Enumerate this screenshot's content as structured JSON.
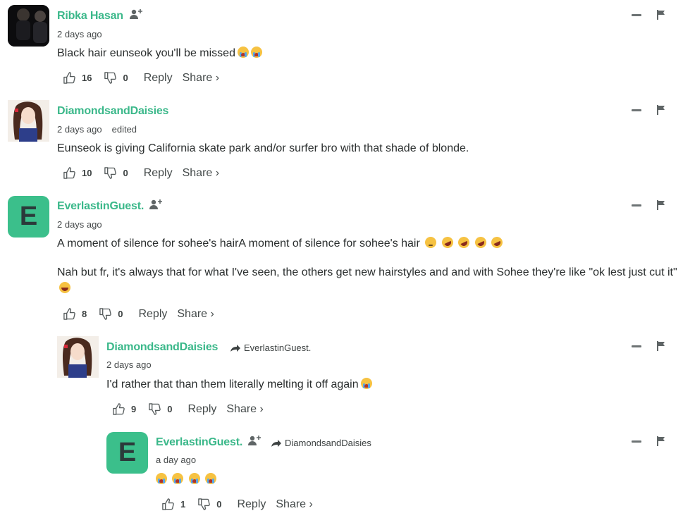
{
  "colors": {
    "accent": "#3bb88a",
    "avatar_bg": "#3bbf8b",
    "text": "#2a2e2e",
    "muted": "#45494a"
  },
  "icons": {
    "like": "thumbs-up-icon",
    "dislike": "thumbs-down-icon",
    "follow": "add-user-icon",
    "reply_arrow": "reply-arrow-icon",
    "collapse": "minus-icon",
    "flag": "flag-icon"
  },
  "labels": {
    "reply": "Reply",
    "share": "Share ›"
  },
  "comments": [
    {
      "name": "Ribka Hasan",
      "time": "2 days ago",
      "edited": "",
      "text": [
        "Black hair eunseok you'll be missed"
      ],
      "likes": "16",
      "dislikes": "0"
    },
    {
      "name": "DiamondsandDaisies",
      "time": "2 days ago",
      "edited": "edited",
      "text": [
        "Eunseok is giving California skate park and/or surfer bro with that shade of blonde."
      ],
      "likes": "10",
      "dislikes": "0"
    },
    {
      "name": "EverlastinGuest.",
      "avatar_letter": "E",
      "time": "2 days ago",
      "edited": "",
      "text": [
        "A moment of silence for sohee's hairA moment of silence for sohee's hair",
        "Nah but fr, it's always that for what I've seen, the others get new hairstyles and and with Sohee they're like \"ok lest just cut it\""
      ],
      "likes": "8",
      "dislikes": "0"
    },
    {
      "name": "DiamondsandDaisies",
      "reply_to": "EverlastinGuest.",
      "time": "2 days ago",
      "edited": "",
      "text": [
        "I'd rather that than them literally melting it off again"
      ],
      "likes": "9",
      "dislikes": "0"
    },
    {
      "name": "EverlastinGuest.",
      "avatar_letter": "E",
      "reply_to": "DiamondsandDaisies",
      "time": "a day ago",
      "edited": "",
      "text": [
        ""
      ],
      "likes": "1",
      "dislikes": "0"
    }
  ]
}
